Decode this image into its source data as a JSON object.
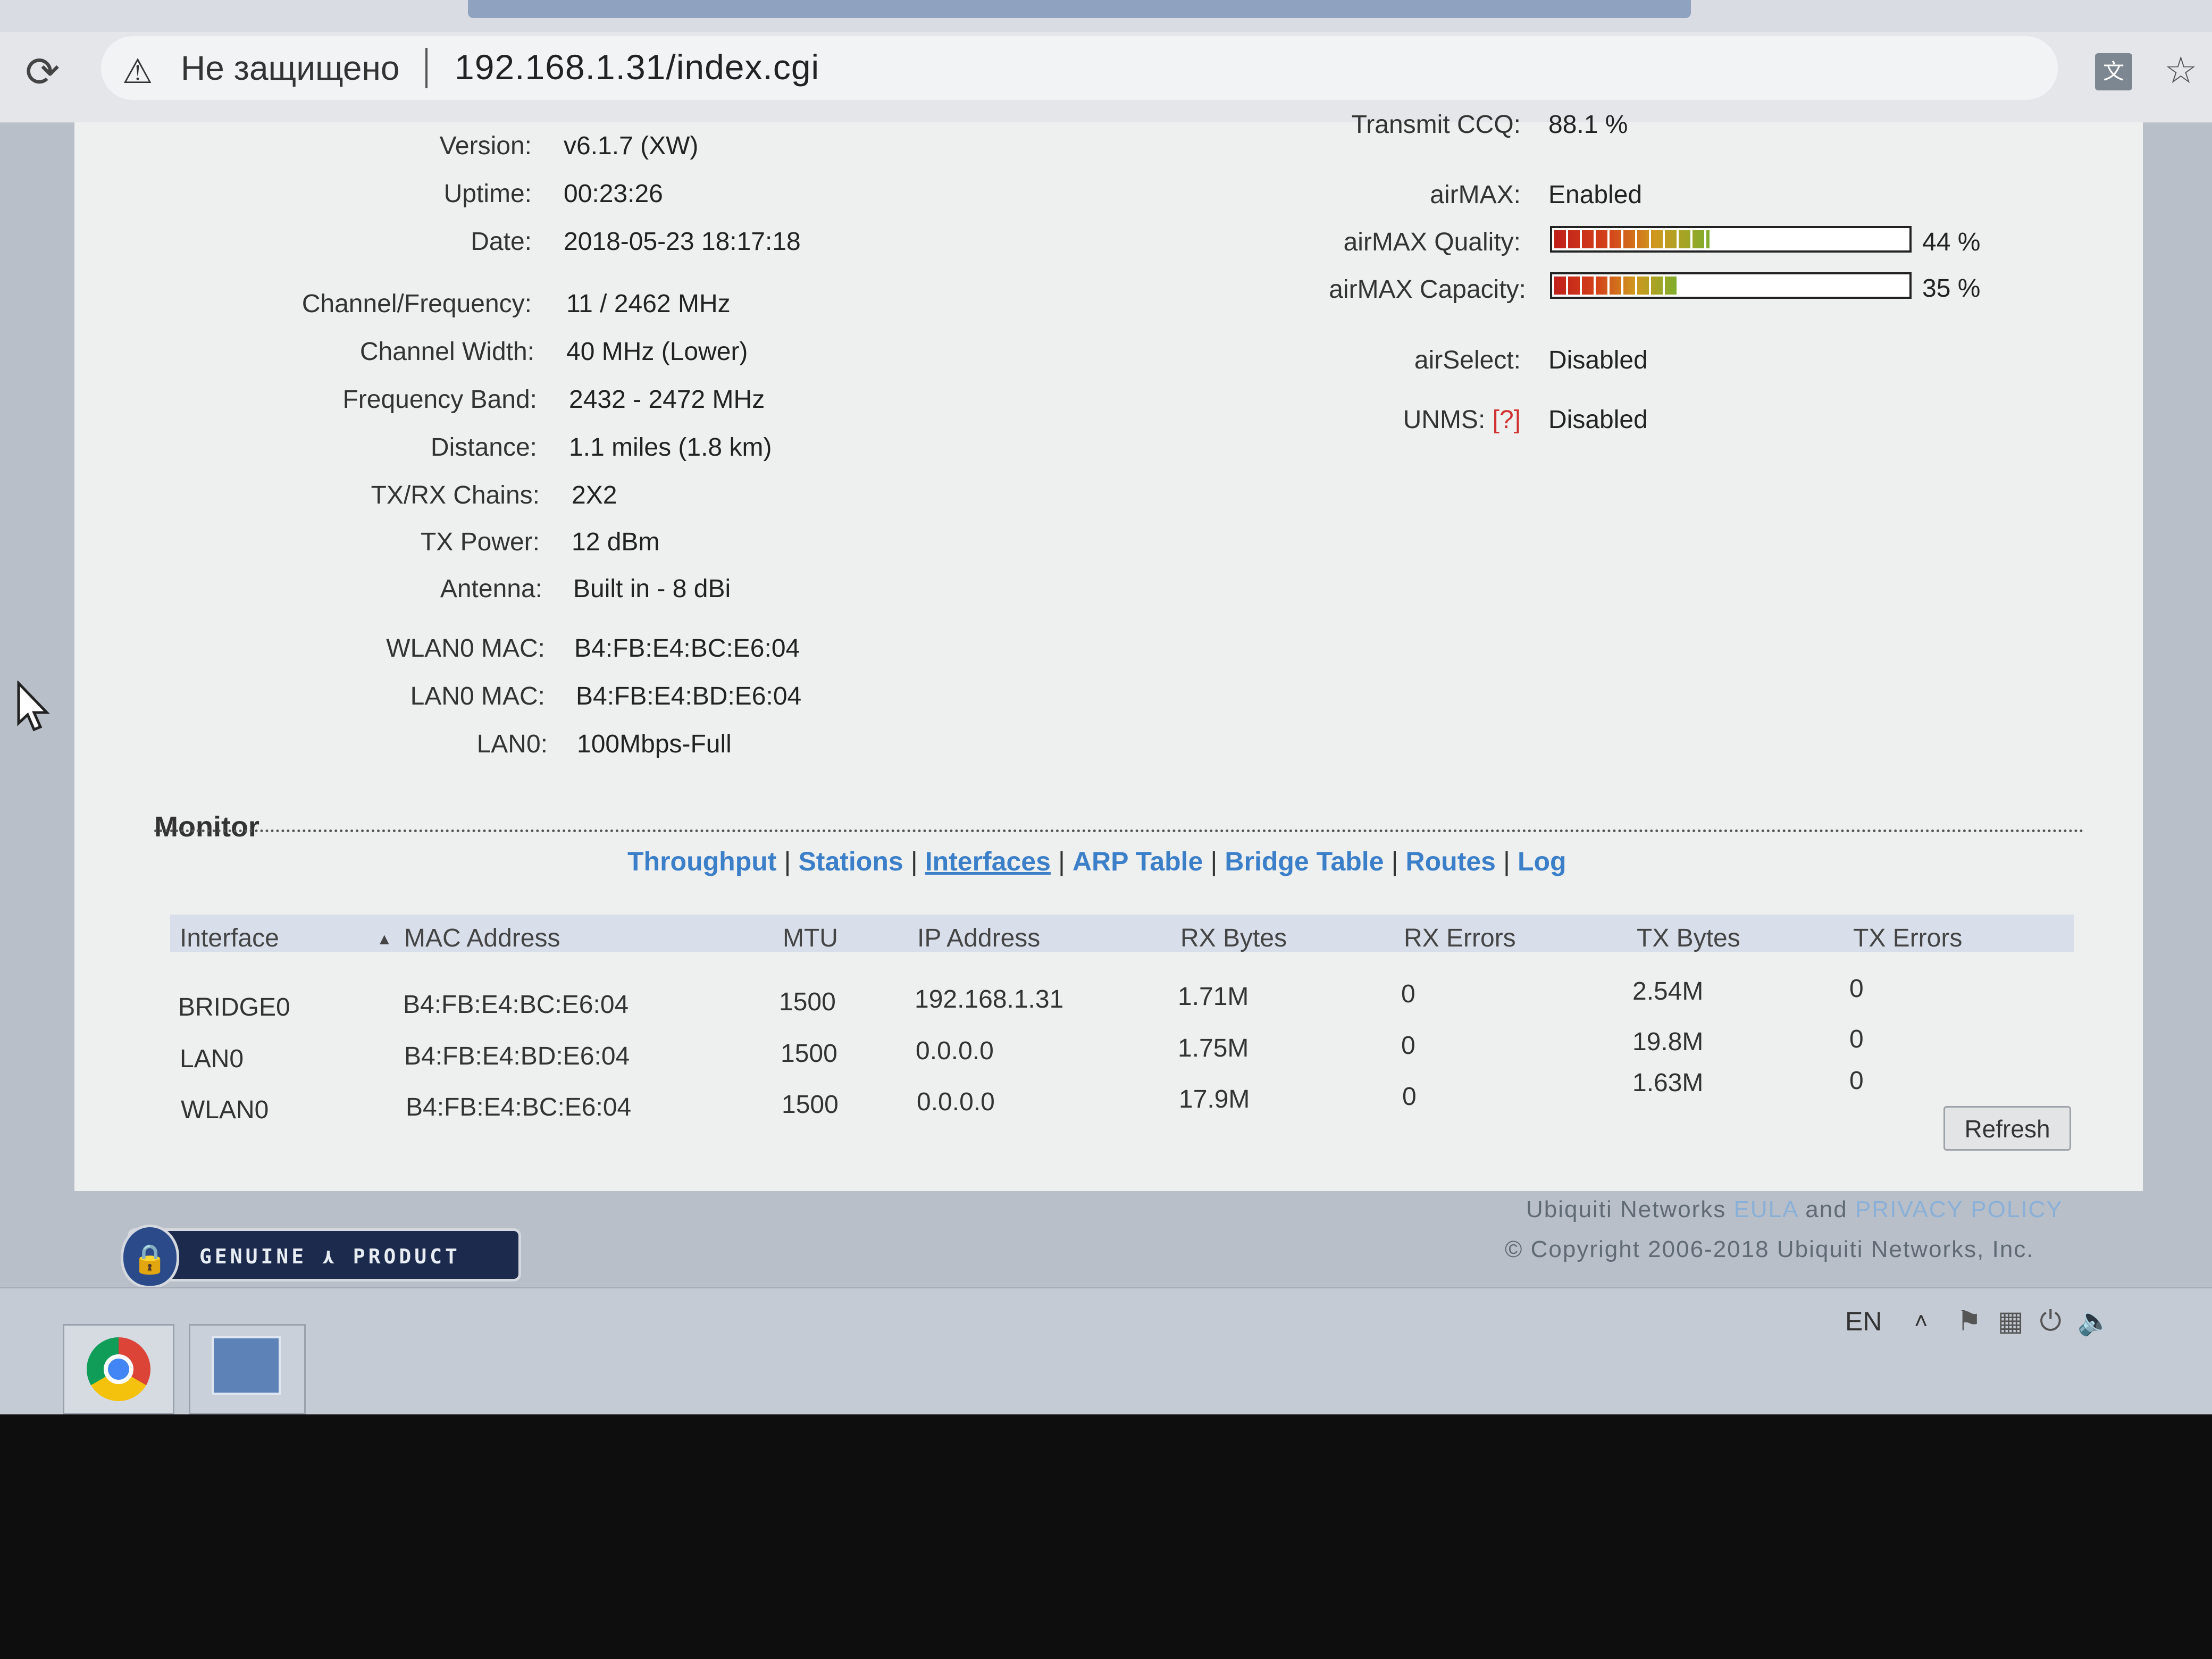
{
  "browser": {
    "security_warning": "Не защищено",
    "url": "192.168.1.31/index.cgi"
  },
  "status": {
    "left": [
      {
        "label": "Version:",
        "value": "v6.1.7 (XW)"
      },
      {
        "label": "Uptime:",
        "value": "00:23:26"
      },
      {
        "label": "Date:",
        "value": "2018-05-23 18:17:18"
      },
      {
        "label": "Channel/Frequency:",
        "value": "11 / 2462 MHz"
      },
      {
        "label": "Channel Width:",
        "value": "40 MHz (Lower)"
      },
      {
        "label": "Frequency Band:",
        "value": "2432 - 2472 MHz"
      },
      {
        "label": "Distance:",
        "value": "1.1 miles (1.8 km)"
      },
      {
        "label": "TX/RX Chains:",
        "value": "2X2"
      },
      {
        "label": "TX Power:",
        "value": "12 dBm"
      },
      {
        "label": "Antenna:",
        "value": "Built in - 8 dBi"
      },
      {
        "label": "WLAN0 MAC:",
        "value": "B4:FB:E4:BC:E6:04"
      },
      {
        "label": "LAN0 MAC:",
        "value": "B4:FB:E4:BD:E6:04"
      },
      {
        "label": "LAN0:",
        "value": "100Mbps-Full"
      }
    ],
    "transmit_ccq": {
      "label": "Transmit CCQ:",
      "value": "88.1 %"
    },
    "airmax": {
      "label": "airMAX:",
      "value": "Enabled"
    },
    "airmax_quality": {
      "label": "airMAX Quality:",
      "value": "44 %",
      "percent": 44
    },
    "airmax_capacity": {
      "label": "airMAX Capacity:",
      "value": "35 %",
      "percent": 35
    },
    "airselect": {
      "label": "airSelect:",
      "value": "Disabled"
    },
    "unms": {
      "label": "UNMS:",
      "help": "[?]",
      "value": "Disabled"
    }
  },
  "monitor": {
    "title": "Monitor",
    "tabs": [
      "Throughput",
      "Stations",
      "Interfaces",
      "ARP Table",
      "Bridge Table",
      "Routes",
      "Log"
    ],
    "active_tab": "Interfaces",
    "columns": [
      "Interface",
      "MAC Address",
      "MTU",
      "IP Address",
      "RX Bytes",
      "RX Errors",
      "TX Bytes",
      "TX Errors"
    ],
    "rows": [
      [
        "BRIDGE0",
        "B4:FB:E4:BC:E6:04",
        "1500",
        "192.168.1.31",
        "1.71M",
        "0",
        "2.54M",
        "0"
      ],
      [
        "LAN0",
        "B4:FB:E4:BD:E6:04",
        "1500",
        "0.0.0.0",
        "1.75M",
        "0",
        "19.8M",
        "0"
      ],
      [
        "WLAN0",
        "B4:FB:E4:BC:E6:04",
        "1500",
        "0.0.0.0",
        "17.9M",
        "0",
        "1.63M",
        "0"
      ]
    ],
    "refresh_label": "Refresh"
  },
  "footer": {
    "genuine_label": "GENUINE ⋏ PRODUCT",
    "legal_prefix": "Ubiquiti Networks ",
    "eula": "EULA",
    "and": " and ",
    "privacy": "PRIVACY POLICY",
    "copyright": "© Copyright 2006-2018 Ubiquiti Networks, Inc."
  },
  "taskbar": {
    "language": "EN"
  },
  "icons": {
    "reload": "reload-icon",
    "warning": "warning-icon",
    "translate": "translate-icon",
    "star": "star-icon",
    "cursor": "mouse-cursor-icon",
    "chrome": "chrome-icon"
  }
}
